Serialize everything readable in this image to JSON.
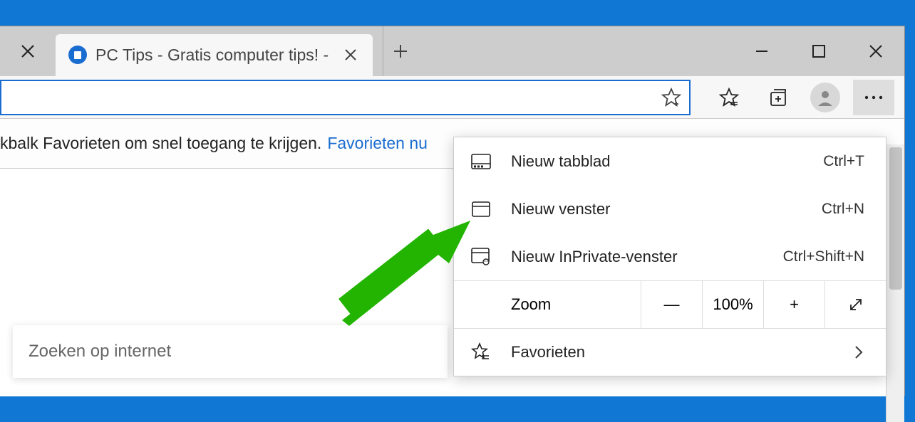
{
  "tab": {
    "title": "PC Tips - Gratis computer tips! -"
  },
  "favbar": {
    "text": "kbalk Favorieten om snel toegang te krijgen.",
    "link": "Favorieten nu"
  },
  "search": {
    "placeholder": "Zoeken op internet"
  },
  "menu": {
    "items": [
      {
        "label": "Nieuw tabblad",
        "shortcut": "Ctrl+T"
      },
      {
        "label": "Nieuw venster",
        "shortcut": "Ctrl+N"
      },
      {
        "label": "Nieuw InPrivate-venster",
        "shortcut": "Ctrl+Shift+N"
      }
    ],
    "zoom": {
      "label": "Zoom",
      "minus": "—",
      "value": "100%",
      "plus": "+"
    },
    "fav": {
      "label": "Favorieten"
    }
  }
}
